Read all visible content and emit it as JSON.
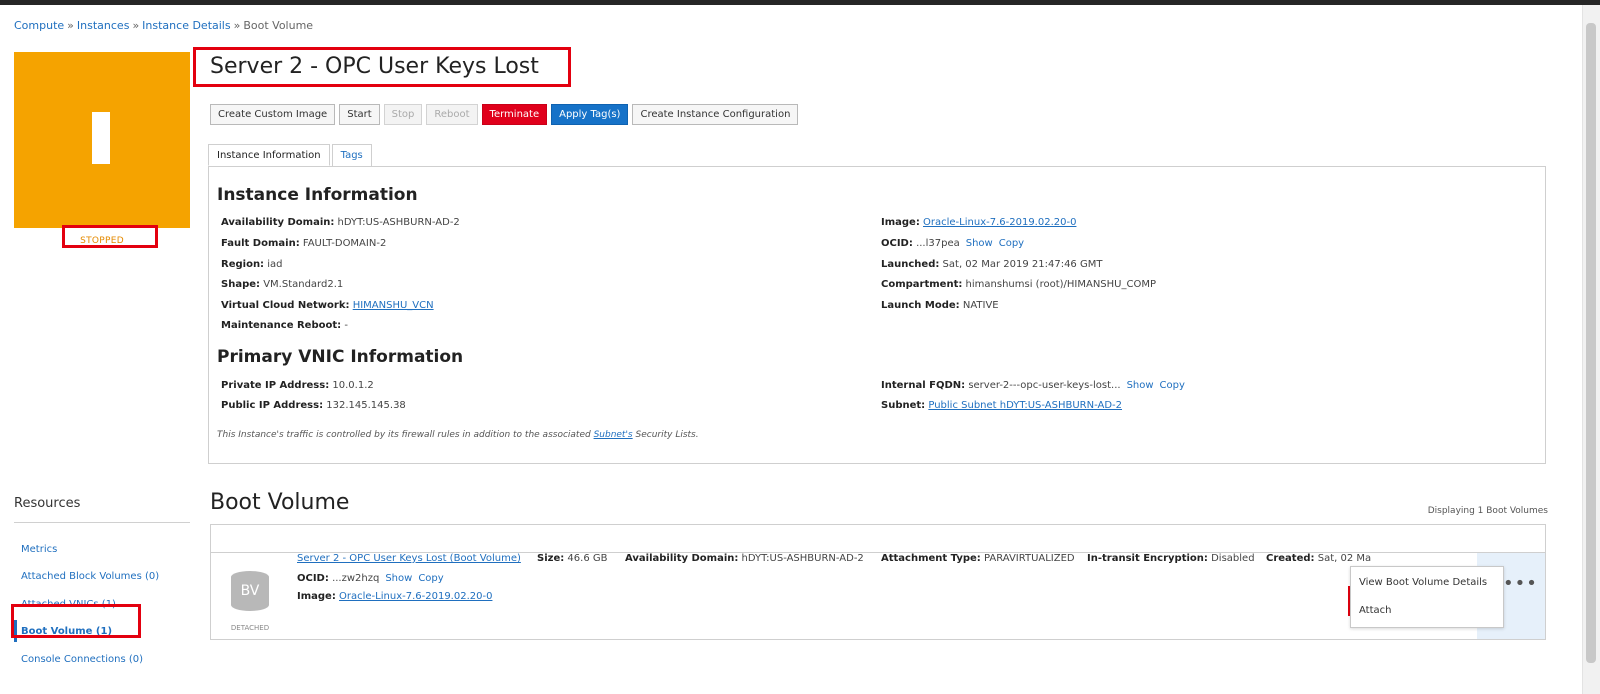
{
  "breadcrumb": {
    "items": [
      "Compute",
      "Instances",
      "Instance Details"
    ],
    "current": "Boot Volume",
    "separator": "»"
  },
  "instance": {
    "state": "STOPPED",
    "title": "Server 2 - OPC User Keys Lost",
    "tile_color": "#f5a300"
  },
  "toolbar": {
    "create_custom_image": "Create Custom Image",
    "start": "Start",
    "stop": "Stop",
    "reboot": "Reboot",
    "terminate": "Terminate",
    "apply_tags": "Apply Tag(s)",
    "create_instance_config": "Create Instance Configuration"
  },
  "tabs": {
    "instance_info": "Instance Information",
    "tags": "Tags"
  },
  "info": {
    "heading": "Instance Information",
    "availability_domain": {
      "label": "Availability Domain:",
      "value": "hDYT:US-ASHBURN-AD-2"
    },
    "fault_domain": {
      "label": "Fault Domain:",
      "value": "FAULT-DOMAIN-2"
    },
    "region": {
      "label": "Region:",
      "value": "iad"
    },
    "shape": {
      "label": "Shape:",
      "value": "VM.Standard2.1"
    },
    "vcn": {
      "label": "Virtual Cloud Network:",
      "value": "HIMANSHU_VCN"
    },
    "maintenance_reboot": {
      "label": "Maintenance Reboot:",
      "value": "-"
    },
    "image": {
      "label": "Image:",
      "value": "Oracle-Linux-7.6-2019.02.20-0"
    },
    "ocid": {
      "label": "OCID:",
      "value": "...l37pea",
      "show": "Show",
      "copy": "Copy"
    },
    "launched": {
      "label": "Launched:",
      "value": "Sat, 02 Mar 2019 21:47:46 GMT"
    },
    "compartment": {
      "label": "Compartment:",
      "value": "himanshumsi (root)/HIMANSHU_COMP"
    },
    "launch_mode": {
      "label": "Launch Mode:",
      "value": "NATIVE"
    }
  },
  "vnic": {
    "heading": "Primary VNIC Information",
    "private_ip": {
      "label": "Private IP Address:",
      "value": "10.0.1.2"
    },
    "public_ip": {
      "label": "Public IP Address:",
      "value": "132.145.145.38"
    },
    "internal_fqdn": {
      "label": "Internal FQDN:",
      "value": "server-2---opc-user-keys-lost...",
      "show": "Show",
      "copy": "Copy"
    },
    "subnet": {
      "label": "Subnet:",
      "value": "Public Subnet hDYT:US-ASHBURN-AD-2"
    },
    "note_pre": "This Instance's traffic is controlled by its firewall rules in addition to the associated ",
    "note_link": "Subnet's",
    "note_post": " Security Lists."
  },
  "resources": {
    "heading": "Resources",
    "items": [
      "Metrics",
      "Attached Block Volumes (0)",
      "Attached VNICs (1)",
      "Boot Volume (1)",
      "Console Connections (0)"
    ]
  },
  "boot_volume": {
    "heading": "Boot Volume",
    "displaying": "Displaying 1 Boot Volumes",
    "icon_text": "BV",
    "status": "DETACHED",
    "name": "Server 2 - OPC User Keys Lost (Boot Volume)",
    "ocid": {
      "label": "OCID:",
      "value": "...zw2hzq",
      "show": "Show",
      "copy": "Copy"
    },
    "image": {
      "label": "Image:",
      "value": "Oracle-Linux-7.6-2019.02.20-0"
    },
    "size": {
      "label": "Size:",
      "value": "46.6 GB"
    },
    "availability_domain": {
      "label": "Availability Domain:",
      "value": "hDYT:US-ASHBURN-AD-2"
    },
    "attachment_type": {
      "label": "Attachment Type:",
      "value": "PARAVIRTUALIZED"
    },
    "in_transit": {
      "label": "In-transit Encryption:",
      "value": "Disabled"
    },
    "created": {
      "label": "Created:",
      "value": "Sat, 02 Ma"
    }
  },
  "actions_menu": {
    "view_details": "View Boot Volume Details",
    "attach": "Attach"
  }
}
